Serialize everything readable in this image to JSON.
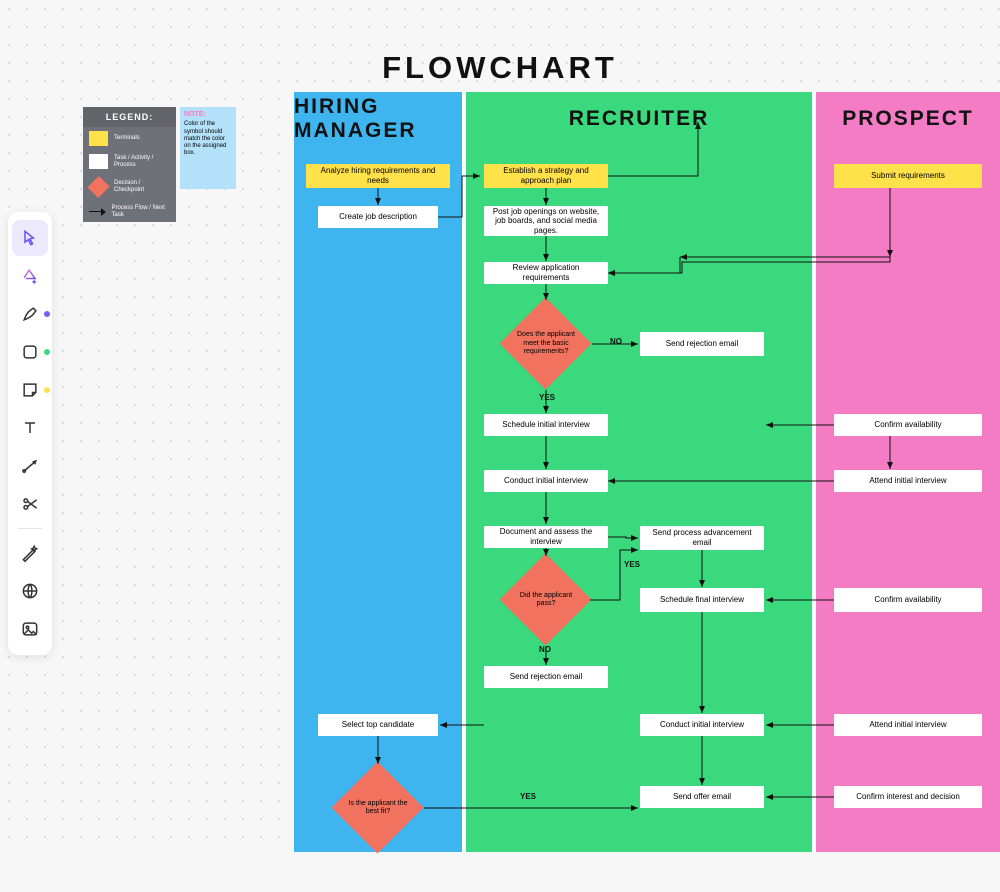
{
  "title": "FLOWCHART",
  "lanes": {
    "hm": "HIRING MANAGER",
    "rc": "RECRUITER",
    "pr": "PROSPECT"
  },
  "legend": {
    "title": "LEGEND:",
    "terminals": "Terminals",
    "task": "Task / Activity / Process",
    "decision": "Decision / Checkpoint",
    "flow": "Process Flow / Next Task"
  },
  "note": {
    "title": "NOTE:",
    "body": "Color of the symbol should match the color on the assigned box."
  },
  "nodes": {
    "hm1": "Analyze hiring requirements and needs",
    "hm2": "Create job description",
    "hm3": "Select top candidate",
    "hm_d1": "Is the applicant the best fit?",
    "rc1": "Establish a strategy and approach plan",
    "rc2": "Post job openings on website, job boards, and social media pages.",
    "rc3": "Review application requirements",
    "rc_d1": "Does the applicant meet the basic requirements?",
    "rc4": "Send rejection email",
    "rc5": "Schedule initial interview",
    "rc6": "Conduct initial interview",
    "rc7": "Document and assess the interview",
    "rc_d2": "Did the applicant pass?",
    "rc8": "Send process advancement email",
    "rc9": "Schedule final interview",
    "rc10": "Send rejection email",
    "rc11": "Conduct initial interview",
    "rc12": "Send offer email",
    "pr1": "Submit requirements",
    "pr2": "Confirm availability",
    "pr3": "Attend initial interview",
    "pr4": "Confirm availability",
    "pr5": "Attend initial interview",
    "pr6": "Confirm interest and decision"
  },
  "labels": {
    "yes": "YES",
    "no": "NO"
  },
  "tools": {
    "select": "select",
    "ai": "ai",
    "pen": "pen",
    "shape": "shape",
    "sticky": "sticky",
    "text": "text",
    "connector": "connector",
    "scissors": "scissors",
    "magic": "magic",
    "web": "web",
    "image": "image"
  },
  "accent": {
    "pen": "#7a5cf6",
    "shape": "#3bd97d",
    "sticky": "#ffe14a"
  }
}
